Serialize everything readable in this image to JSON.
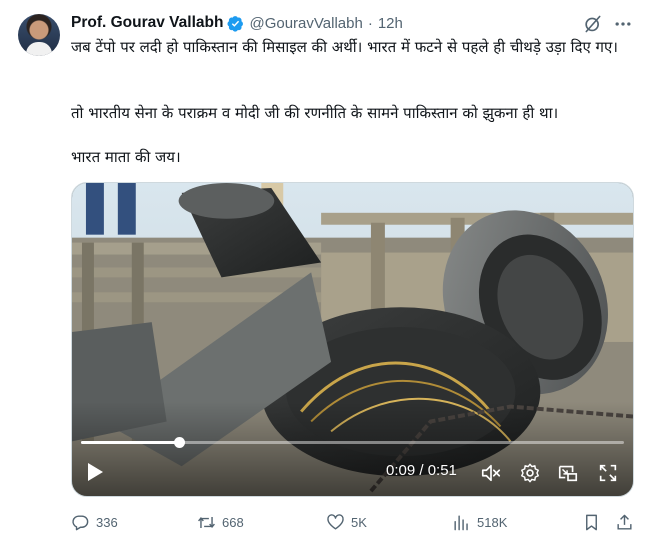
{
  "author": {
    "display_name": "Prof. Gourav Vallabh",
    "handle": "@GouravVallabh",
    "separator": "·",
    "time": "12h",
    "verified": true
  },
  "tweet": {
    "line1": "जब टेंपो पर लदी हो पाकिस्तान की मिसाइल की अर्थी। भारत में फटने से पहले ही चीथड़े उड़ा दिए गए।",
    "line2": "तो भारतीय सेना के पराक्रम व मोदी जी की रणनीति के सामने पाकिस्तान को झुकना ही था।",
    "line3": "भारत माता की जय।"
  },
  "video": {
    "timecode": "0:09 / 0:51",
    "progress_fraction": 0.18
  },
  "actions": {
    "replies": "336",
    "reposts": "668",
    "likes": "5K",
    "views": "518K"
  },
  "icons": {
    "verified": "verified-badge-icon",
    "grok": "grok-icon",
    "more": "more-icon",
    "play": "play-icon",
    "mute": "mute-icon",
    "settings": "settings-icon",
    "pip": "picture-in-picture-icon",
    "fullscreen": "fullscreen-icon",
    "reply": "reply-icon",
    "repost": "repost-icon",
    "like": "heart-icon",
    "views": "views-icon",
    "bookmark": "bookmark-icon",
    "share": "share-icon"
  },
  "colors": {
    "accent": "#1d9bf0",
    "text": "#0f1419",
    "secondary": "#536471"
  }
}
